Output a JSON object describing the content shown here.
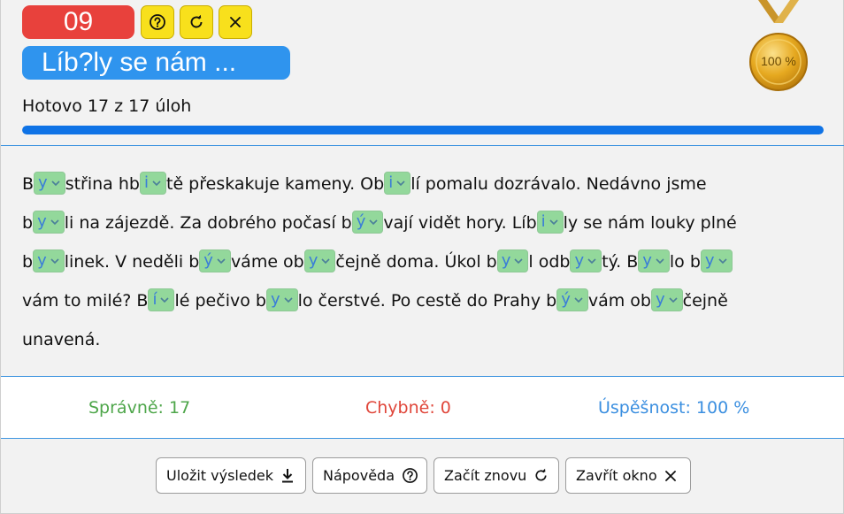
{
  "header": {
    "exercise_number": "09",
    "title": "Líb?ly se nám ...",
    "progress_text": "Hotovo 17 z 17 úloh",
    "progress_fraction": 1.0,
    "medal_label": "100 %",
    "buttons": [
      {
        "name": "help-icon-button",
        "icon": "question-circle-icon"
      },
      {
        "name": "restart-icon-button",
        "icon": "refresh-icon"
      },
      {
        "name": "close-icon-button",
        "icon": "close-icon"
      }
    ]
  },
  "exercise": {
    "lines": [
      [
        "B",
        {
          "sel": "y"
        },
        "střina hb",
        {
          "sel": "i"
        },
        "tě přeskakuje kameny. Ob",
        {
          "sel": "i"
        },
        "lí pomalu dozrávalo. Nedávno jsme"
      ],
      [
        "b",
        {
          "sel": "y"
        },
        "li na zájezdě. Za dobrého počasí b",
        {
          "sel": "ý"
        },
        "vají vidět hory. Líb",
        {
          "sel": "i"
        },
        "ly se nám louky plné"
      ],
      [
        "b",
        {
          "sel": "y"
        },
        "linek. V neděli b",
        {
          "sel": "ý"
        },
        "váme ob",
        {
          "sel": "y"
        },
        "čejně doma. Úkol b",
        {
          "sel": "y"
        },
        "l odb",
        {
          "sel": "y"
        },
        "tý. B",
        {
          "sel": "y"
        },
        "lo b",
        {
          "sel": "y"
        }
      ],
      [
        "vám to milé? B",
        {
          "sel": "í"
        },
        "lé pečivo b",
        {
          "sel": "y"
        },
        "lo čerstvé. Po cestě do Prahy b",
        {
          "sel": "ý"
        },
        "vám ob",
        {
          "sel": "y"
        },
        "čejně"
      ],
      [
        "unavená."
      ]
    ]
  },
  "stats": {
    "correct": "Správně: 17",
    "wrong": "Chybně: 0",
    "success": "Úspěšnost: 100 %"
  },
  "footer": {
    "save_label": "Uložit výsledek",
    "help_label": "Nápověda",
    "restart_label": "Začít znovu",
    "close_label": "Zavřít okno"
  },
  "colors": {
    "number_badge": "#e8413c",
    "title_badge": "#2f94ee",
    "icon_button": "#f8e01c",
    "progress": "#0f73e6",
    "select_bg": "#93d89b",
    "correct": "#4ea64a",
    "wrong": "#e0463a",
    "success": "#3b8fe0"
  }
}
